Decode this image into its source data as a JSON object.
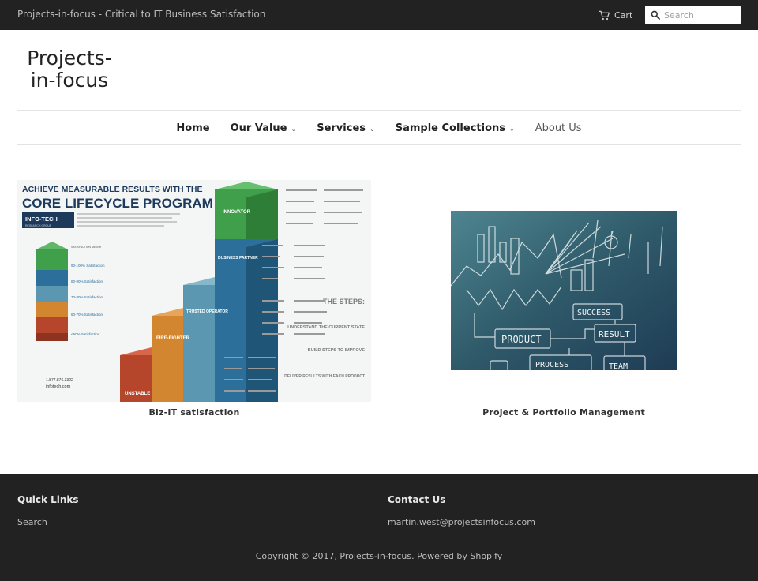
{
  "header": {
    "tagline": "Projects-in-focus - Critical to IT Business Satisfaction",
    "cart_label": "Cart",
    "search_placeholder": "Search",
    "cart_icon": "cart-icon",
    "search_icon": "search-icon"
  },
  "logo": {
    "line1": "Projects-",
    "line2": "in-focus"
  },
  "nav": {
    "items": [
      {
        "label": "Home",
        "dropdown": false
      },
      {
        "label": "Our Value",
        "dropdown": true
      },
      {
        "label": "Services",
        "dropdown": true
      },
      {
        "label": "Sample Collections",
        "dropdown": true
      },
      {
        "label": "About Us",
        "dropdown": false
      }
    ],
    "chevron": "⌄"
  },
  "collections": [
    {
      "title": "Biz-IT satisfaction",
      "image": {
        "heading_line1": "ACHIEVE MEASURABLE RESULTS WITH THE",
        "heading_line2": "CORE LIFECYCLE PROGRAM",
        "logo_text": "INFO-TECH",
        "logo_sub": "RESEARCH GROUP",
        "stairs": [
          "UNSTABLE",
          "FIRE-FIGHTER",
          "TRUSTED OPERATOR",
          "BUSINESS PARTNER",
          "INNOVATOR"
        ],
        "steps_title": "THE STEPS:",
        "steps": [
          "UNDERSTAND THE CURRENT STATE",
          "BUILD STEPS TO IMPROVE",
          "DELIVER RESULTS WITH EACH PRODUCT"
        ],
        "meter_label": "SATISFACTION METER",
        "meter_levels": [
          "90-100% Satisfaction",
          "80-90% Satisfaction",
          "70-80% Satisfaction",
          "60-70% Satisfaction",
          "<60% Satisfaction"
        ],
        "phone": "1.877.876.3322",
        "site": "infotech.com"
      }
    },
    {
      "title": "Project & Portfolio Management",
      "image": {
        "words": [
          "SUCCESS",
          "RESULT",
          "PRODUCT",
          "PROCESS",
          "TEAM"
        ]
      }
    }
  ],
  "footer": {
    "quick_links_heading": "Quick Links",
    "quick_links": [
      "Search"
    ],
    "contact_heading": "Contact Us",
    "contact_email": "martin.west@projectsinfocus.com",
    "copyright": "Copyright © 2017, Projects-in-focus. Powered by Shopify"
  },
  "colors": {
    "bar_bg": "#222222",
    "stair_green": "#3f9f4a",
    "stair_blue": "#2b6f9a",
    "stair_teal": "#5b97b0",
    "stair_orange": "#d2862f",
    "stair_red": "#b5452b",
    "chalkboard": "#2f5a6a"
  }
}
